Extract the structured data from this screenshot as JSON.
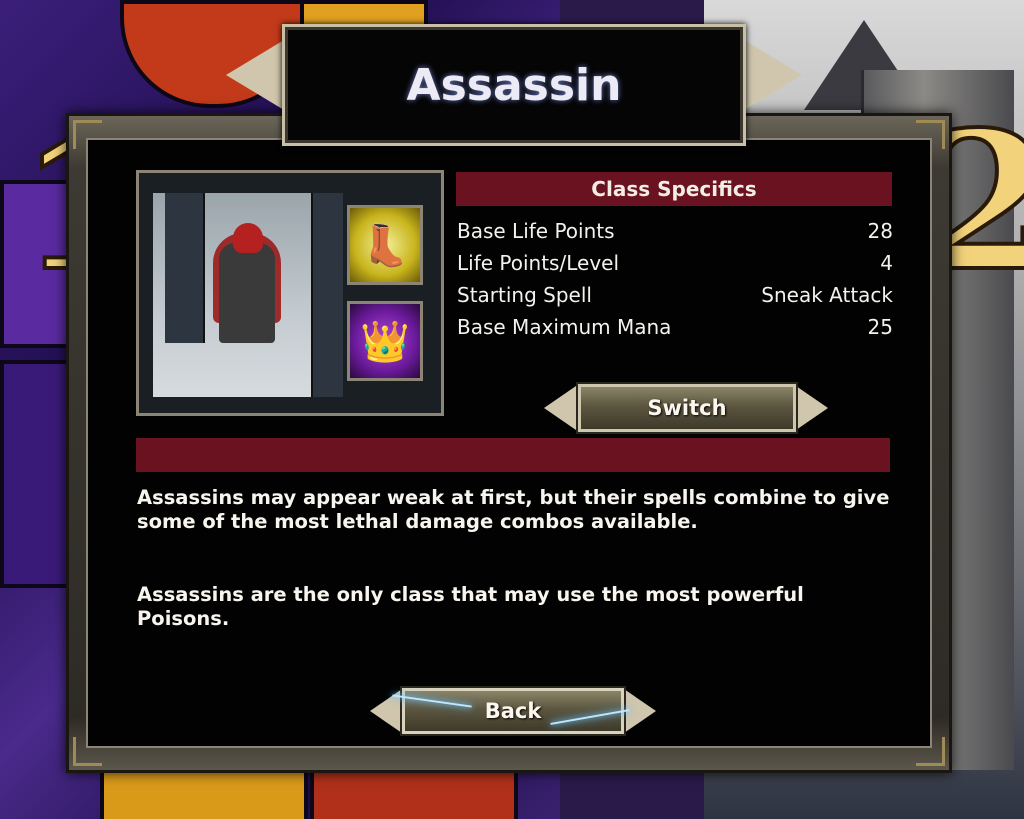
{
  "title": "Assassin",
  "class_specifics": {
    "header": "Class Specifics",
    "stats": [
      {
        "label": "Base Life Points",
        "value": "28"
      },
      {
        "label": "Life Points/Level",
        "value": "4"
      },
      {
        "label": "Starting Spell",
        "value": "Sneak Attack"
      },
      {
        "label": "Base Maximum Mana",
        "value": "25"
      }
    ]
  },
  "buttons": {
    "switch_label": "Switch",
    "back_label": "Back"
  },
  "description": {
    "paragraph_1": "Assassins may appear weak at first, but their spells combine to give some of the most lethal damage combos available.",
    "paragraph_2": "Assassins are the only class that may use the most powerful Poisons."
  },
  "icons": {
    "skill_1": "boot-icon",
    "skill_2": "crown-icon"
  },
  "colors": {
    "header_bar": "#6b1221",
    "panel_background": "#020202",
    "text": "#f4f2ee"
  }
}
